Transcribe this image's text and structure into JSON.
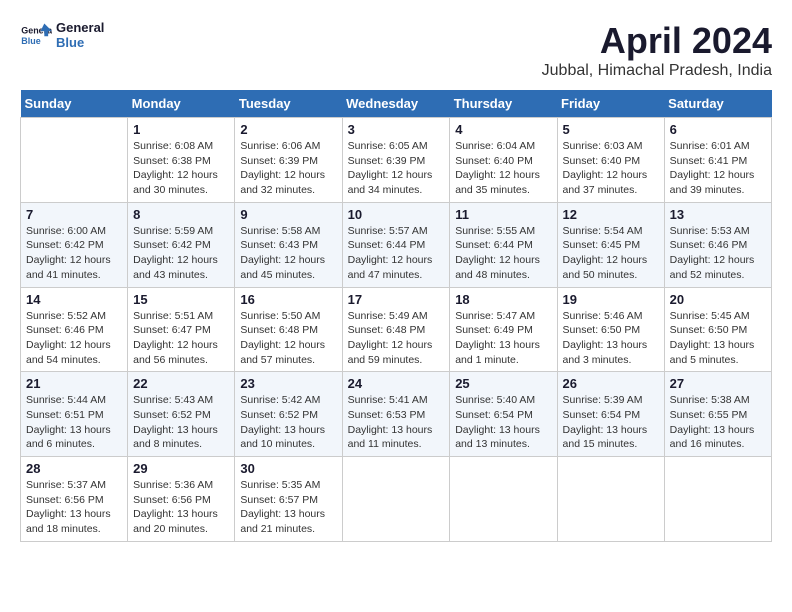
{
  "logo": {
    "line1": "General",
    "line2": "Blue"
  },
  "title": "April 2024",
  "subtitle": "Jubbal, Himachal Pradesh, India",
  "weekdays": [
    "Sunday",
    "Monday",
    "Tuesday",
    "Wednesday",
    "Thursday",
    "Friday",
    "Saturday"
  ],
  "weeks": [
    [
      {
        "day": "",
        "info": ""
      },
      {
        "day": "1",
        "info": "Sunrise: 6:08 AM\nSunset: 6:38 PM\nDaylight: 12 hours\nand 30 minutes."
      },
      {
        "day": "2",
        "info": "Sunrise: 6:06 AM\nSunset: 6:39 PM\nDaylight: 12 hours\nand 32 minutes."
      },
      {
        "day": "3",
        "info": "Sunrise: 6:05 AM\nSunset: 6:39 PM\nDaylight: 12 hours\nand 34 minutes."
      },
      {
        "day": "4",
        "info": "Sunrise: 6:04 AM\nSunset: 6:40 PM\nDaylight: 12 hours\nand 35 minutes."
      },
      {
        "day": "5",
        "info": "Sunrise: 6:03 AM\nSunset: 6:40 PM\nDaylight: 12 hours\nand 37 minutes."
      },
      {
        "day": "6",
        "info": "Sunrise: 6:01 AM\nSunset: 6:41 PM\nDaylight: 12 hours\nand 39 minutes."
      }
    ],
    [
      {
        "day": "7",
        "info": "Sunrise: 6:00 AM\nSunset: 6:42 PM\nDaylight: 12 hours\nand 41 minutes."
      },
      {
        "day": "8",
        "info": "Sunrise: 5:59 AM\nSunset: 6:42 PM\nDaylight: 12 hours\nand 43 minutes."
      },
      {
        "day": "9",
        "info": "Sunrise: 5:58 AM\nSunset: 6:43 PM\nDaylight: 12 hours\nand 45 minutes."
      },
      {
        "day": "10",
        "info": "Sunrise: 5:57 AM\nSunset: 6:44 PM\nDaylight: 12 hours\nand 47 minutes."
      },
      {
        "day": "11",
        "info": "Sunrise: 5:55 AM\nSunset: 6:44 PM\nDaylight: 12 hours\nand 48 minutes."
      },
      {
        "day": "12",
        "info": "Sunrise: 5:54 AM\nSunset: 6:45 PM\nDaylight: 12 hours\nand 50 minutes."
      },
      {
        "day": "13",
        "info": "Sunrise: 5:53 AM\nSunset: 6:46 PM\nDaylight: 12 hours\nand 52 minutes."
      }
    ],
    [
      {
        "day": "14",
        "info": "Sunrise: 5:52 AM\nSunset: 6:46 PM\nDaylight: 12 hours\nand 54 minutes."
      },
      {
        "day": "15",
        "info": "Sunrise: 5:51 AM\nSunset: 6:47 PM\nDaylight: 12 hours\nand 56 minutes."
      },
      {
        "day": "16",
        "info": "Sunrise: 5:50 AM\nSunset: 6:48 PM\nDaylight: 12 hours\nand 57 minutes."
      },
      {
        "day": "17",
        "info": "Sunrise: 5:49 AM\nSunset: 6:48 PM\nDaylight: 12 hours\nand 59 minutes."
      },
      {
        "day": "18",
        "info": "Sunrise: 5:47 AM\nSunset: 6:49 PM\nDaylight: 13 hours\nand 1 minute."
      },
      {
        "day": "19",
        "info": "Sunrise: 5:46 AM\nSunset: 6:50 PM\nDaylight: 13 hours\nand 3 minutes."
      },
      {
        "day": "20",
        "info": "Sunrise: 5:45 AM\nSunset: 6:50 PM\nDaylight: 13 hours\nand 5 minutes."
      }
    ],
    [
      {
        "day": "21",
        "info": "Sunrise: 5:44 AM\nSunset: 6:51 PM\nDaylight: 13 hours\nand 6 minutes."
      },
      {
        "day": "22",
        "info": "Sunrise: 5:43 AM\nSunset: 6:52 PM\nDaylight: 13 hours\nand 8 minutes."
      },
      {
        "day": "23",
        "info": "Sunrise: 5:42 AM\nSunset: 6:52 PM\nDaylight: 13 hours\nand 10 minutes."
      },
      {
        "day": "24",
        "info": "Sunrise: 5:41 AM\nSunset: 6:53 PM\nDaylight: 13 hours\nand 11 minutes."
      },
      {
        "day": "25",
        "info": "Sunrise: 5:40 AM\nSunset: 6:54 PM\nDaylight: 13 hours\nand 13 minutes."
      },
      {
        "day": "26",
        "info": "Sunrise: 5:39 AM\nSunset: 6:54 PM\nDaylight: 13 hours\nand 15 minutes."
      },
      {
        "day": "27",
        "info": "Sunrise: 5:38 AM\nSunset: 6:55 PM\nDaylight: 13 hours\nand 16 minutes."
      }
    ],
    [
      {
        "day": "28",
        "info": "Sunrise: 5:37 AM\nSunset: 6:56 PM\nDaylight: 13 hours\nand 18 minutes."
      },
      {
        "day": "29",
        "info": "Sunrise: 5:36 AM\nSunset: 6:56 PM\nDaylight: 13 hours\nand 20 minutes."
      },
      {
        "day": "30",
        "info": "Sunrise: 5:35 AM\nSunset: 6:57 PM\nDaylight: 13 hours\nand 21 minutes."
      },
      {
        "day": "",
        "info": ""
      },
      {
        "day": "",
        "info": ""
      },
      {
        "day": "",
        "info": ""
      },
      {
        "day": "",
        "info": ""
      }
    ]
  ]
}
